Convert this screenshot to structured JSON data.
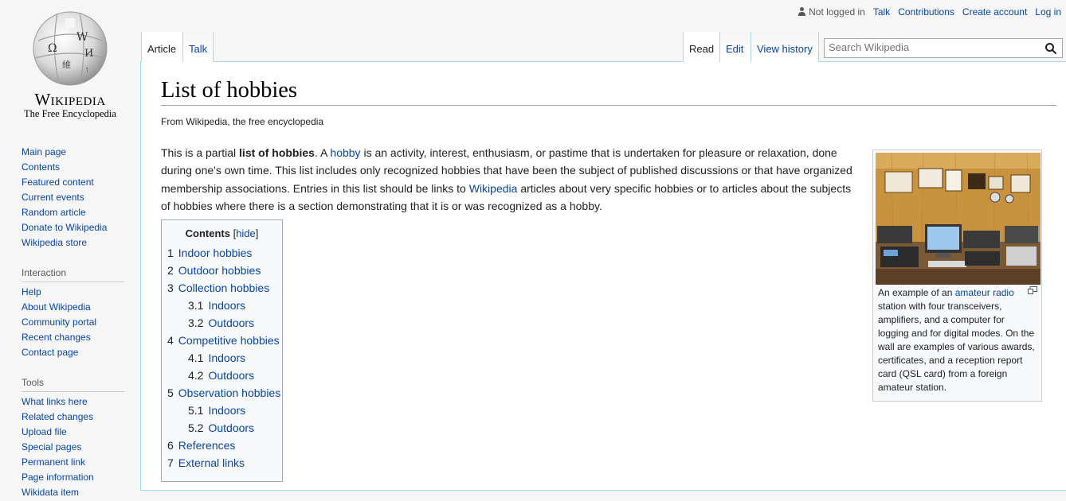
{
  "personal_tools": {
    "not_logged_in": "Not logged in",
    "talk": "Talk",
    "contributions": "Contributions",
    "create_account": "Create account",
    "log_in": "Log in"
  },
  "logo": {
    "wordmark": "Wikipedia",
    "tagline": "The Free Encyclopedia"
  },
  "sidebar": {
    "navigation": [
      "Main page",
      "Contents",
      "Featured content",
      "Current events",
      "Random article",
      "Donate to Wikipedia",
      "Wikipedia store"
    ],
    "interaction_heading": "Interaction",
    "interaction": [
      "Help",
      "About Wikipedia",
      "Community portal",
      "Recent changes",
      "Contact page"
    ],
    "tools_heading": "Tools",
    "tools": [
      "What links here",
      "Related changes",
      "Upload file",
      "Special pages",
      "Permanent link",
      "Page information",
      "Wikidata item"
    ]
  },
  "tabs": {
    "article": "Article",
    "talk": "Talk",
    "read": "Read",
    "edit": "Edit",
    "view_history": "View history"
  },
  "search": {
    "placeholder": "Search Wikipedia"
  },
  "article": {
    "title": "List of hobbies",
    "site_sub": "From Wikipedia, the free encyclopedia",
    "intro": {
      "p1": "This is a partial ",
      "bold": "list of hobbies",
      "p2": ". A ",
      "link1": "hobby",
      "p3": " is an activity, interest, enthusiasm, or pastime that is undertaken for pleasure or relaxation, done during one's own time. This list includes only recognized hobbies that have been the subject of published discussions or that have organized membership associations. Entries in this list should be links to ",
      "link2": "Wikipedia",
      "p4": " articles about very specific hobbies or to articles about the subjects of hobbies where there is a section demonstrating that it is or was recognized as a hobby."
    }
  },
  "toc": {
    "title": "Contents",
    "hide": "hide",
    "items": [
      {
        "num": "1",
        "label": "Indoor hobbies",
        "level": 1
      },
      {
        "num": "2",
        "label": "Outdoor hobbies",
        "level": 1
      },
      {
        "num": "3",
        "label": "Collection hobbies",
        "level": 1
      },
      {
        "num": "3.1",
        "label": "Indoors",
        "level": 2
      },
      {
        "num": "3.2",
        "label": "Outdoors",
        "level": 2
      },
      {
        "num": "4",
        "label": "Competitive hobbies",
        "level": 1
      },
      {
        "num": "4.1",
        "label": "Indoors",
        "level": 2
      },
      {
        "num": "4.2",
        "label": "Outdoors",
        "level": 2
      },
      {
        "num": "5",
        "label": "Observation hobbies",
        "level": 1
      },
      {
        "num": "5.1",
        "label": "Indoors",
        "level": 2
      },
      {
        "num": "5.2",
        "label": "Outdoors",
        "level": 2
      },
      {
        "num": "6",
        "label": "References",
        "level": 1
      },
      {
        "num": "7",
        "label": "External links",
        "level": 1
      }
    ]
  },
  "thumb": {
    "caption_pre": "An example of an ",
    "caption_link": "amateur radio",
    "caption_post": " station with four transceivers, amplifiers, and a computer for logging and for digital modes. On the wall are examples of various awards, certificates, and a reception report card (QSL card) from a foreign amateur station."
  },
  "colors": {
    "link": "#0645ad",
    "border": "#a7d7f9"
  }
}
